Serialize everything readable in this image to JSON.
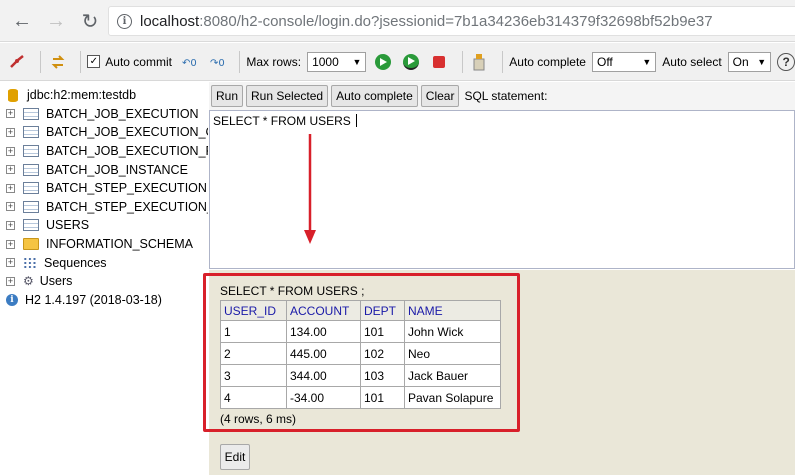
{
  "browser": {
    "url_host": "localhost",
    "url_rest": ":8080/h2-console/login.do?jsessionid=7b1a34236eb314379f32698bf52b9e37"
  },
  "toolbar": {
    "auto_commit_label": "Auto commit",
    "auto_commit_checked": true,
    "max_rows_label": "Max rows:",
    "max_rows_value": "1000",
    "auto_complete_label": "Auto complete",
    "auto_complete_value": "Off",
    "auto_select_label": "Auto select",
    "auto_select_value": "On",
    "help_label": "?"
  },
  "tree": {
    "db_url": "jdbc:h2:mem:testdb",
    "tables": [
      "BATCH_JOB_EXECUTION",
      "BATCH_JOB_EXECUTION_C",
      "BATCH_JOB_EXECUTION_F",
      "BATCH_JOB_INSTANCE",
      "BATCH_STEP_EXECUTION",
      "BATCH_STEP_EXECUTION_",
      "USERS"
    ],
    "schema": "INFORMATION_SCHEMA",
    "sequences": "Sequences",
    "users": "Users",
    "version": "H2 1.4.197 (2018-03-18)"
  },
  "query": {
    "run_label": "Run",
    "run_selected_label": "Run Selected",
    "auto_complete_label": "Auto complete",
    "clear_label": "Clear",
    "sql_label": "SQL statement:",
    "sql_text": "SELECT * FROM USERS "
  },
  "result": {
    "statement": "SELECT * FROM USERS ;",
    "columns": [
      "USER_ID",
      "ACCOUNT",
      "DEPT",
      "NAME"
    ],
    "rows": [
      [
        "1",
        "134.00",
        "101",
        "John Wick"
      ],
      [
        "2",
        "445.00",
        "102",
        "Neo"
      ],
      [
        "3",
        "344.00",
        "103",
        "Jack Bauer"
      ],
      [
        "4",
        "-34.00",
        "101",
        "Pavan Solapure"
      ]
    ],
    "footer": "(4 rows, 6 ms)",
    "edit_label": "Edit"
  },
  "colors": {
    "highlight": "#d8202a",
    "column_header": "#1a1aa8",
    "result_bg": "#eae7d8"
  }
}
